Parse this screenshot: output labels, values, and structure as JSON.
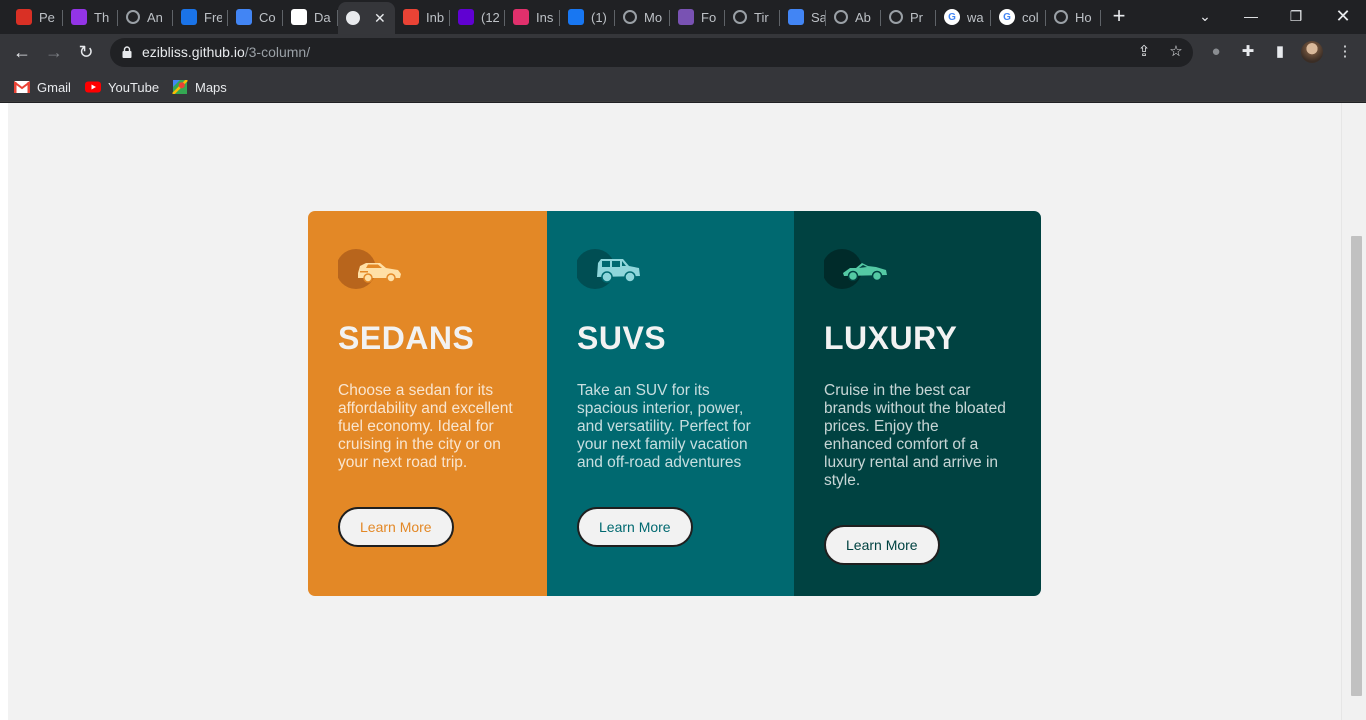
{
  "browser": {
    "tabs": [
      {
        "title": "Pe",
        "icon": "calendar-favicon",
        "color": "#d93025"
      },
      {
        "title": "Th",
        "icon": "purple-u-favicon",
        "color": "#9334e6"
      },
      {
        "title": "An",
        "icon": "globe-favicon",
        "color": "#9aa0a6"
      },
      {
        "title": "Fre",
        "icon": "freecodecamp-c-favicon",
        "color": "#1a73e8"
      },
      {
        "title": "Co",
        "icon": "ui-favicon",
        "color": "#4285f4"
      },
      {
        "title": "Da",
        "icon": "ui-box-favicon",
        "color": "#ffffff"
      },
      {
        "title": "",
        "icon": "active-globe-favicon",
        "color": "#e8eaed"
      },
      {
        "title": "Inb",
        "icon": "gmail-favicon",
        "color": "#ea4335"
      },
      {
        "title": "(12",
        "icon": "yahoo-mail-favicon",
        "color": "#6001d2"
      },
      {
        "title": "Ins",
        "icon": "instagram-favicon",
        "color": "#e1306c"
      },
      {
        "title": "(1)",
        "icon": "facebook-favicon",
        "color": "#1877f2"
      },
      {
        "title": "Mo",
        "icon": "globe-favicon",
        "color": "#9aa0a6"
      },
      {
        "title": "Fo",
        "icon": "bootstrap-favicon",
        "color": "#7952b3"
      },
      {
        "title": "Tir",
        "icon": "globe-favicon",
        "color": "#9aa0a6"
      },
      {
        "title": "Sa",
        "icon": "s-favicon",
        "color": "#4285f4"
      },
      {
        "title": "Ab",
        "icon": "globe-favicon",
        "color": "#9aa0a6"
      },
      {
        "title": "Pr",
        "icon": "globe-favicon",
        "color": "#9aa0a6"
      },
      {
        "title": "wa",
        "icon": "google-favicon",
        "color": "#4285f4"
      },
      {
        "title": "col",
        "icon": "google-favicon",
        "color": "#4285f4"
      },
      {
        "title": "Ho",
        "icon": "globe-favicon",
        "color": "#9aa0a6"
      }
    ],
    "new_tab_label": "+",
    "url_host": "ezibliss.github.io",
    "url_path": "/3-column/",
    "bookmarks": [
      {
        "label": "Gmail",
        "icon": "gmail-icon"
      },
      {
        "label": "YouTube",
        "icon": "youtube-icon"
      },
      {
        "label": "Maps",
        "icon": "maps-icon"
      }
    ]
  },
  "cards": [
    {
      "id": "sedans",
      "icon": "sedan-car-icon",
      "title": "SEDANS",
      "text": "Choose a sedan for its affordability and excellent fuel economy. Ideal for cruising in the city or on your next road trip.",
      "button": "Learn More",
      "color": "#e38826"
    },
    {
      "id": "suvs",
      "icon": "suv-car-icon",
      "title": "SUVS",
      "text": "Take an SUV for its spacious interior, power, and versatility. Perfect for your next family vacation and off-road adventures",
      "button": "Learn More",
      "color": "#006970"
    },
    {
      "id": "luxury",
      "icon": "luxury-car-icon",
      "title": "LUXURY",
      "text": "Cruise in the best car brands without the bloated prices. Enjoy the enhanced comfort of a luxury rental and arrive in style.",
      "button": "Learn More",
      "color": "#004241"
    }
  ],
  "colors": {
    "page_bg": "#f2f2f2",
    "sedans": "#e38826",
    "suvs": "#006970",
    "luxury": "#004241"
  }
}
